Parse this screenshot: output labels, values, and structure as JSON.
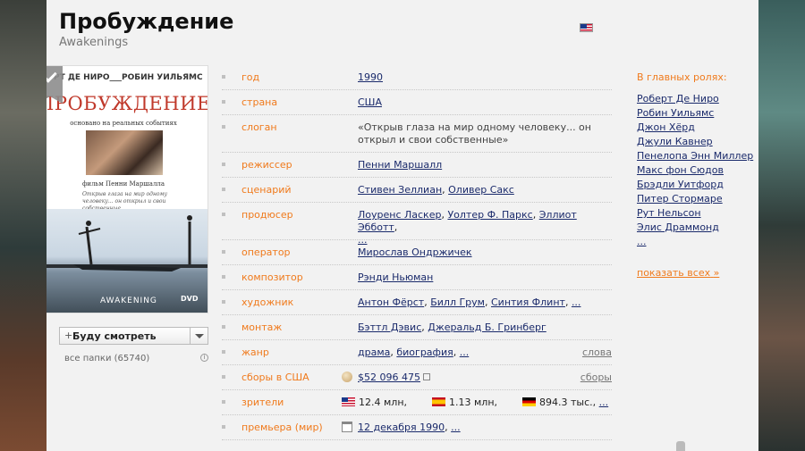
{
  "title": "Пробуждение",
  "original_title": "Awakenings",
  "poster": {
    "actors": "РТ ДЕ НИРО___РОБИН УИЛЬЯМС",
    "title": "ПРОБУЖДЕНИЕ",
    "tagline": "основано на реальных событиях",
    "director_line": "фильм Пенни Маршалла",
    "quote": "Открыв глаза на мир одному человеку... он открыл и свои собственные",
    "bottom": "AWAKENING",
    "dvd": "DVD"
  },
  "watch": {
    "plus": "+",
    "label": "Буду смотреть",
    "folders": "все папки (65740)",
    "info_icon": "i"
  },
  "info": {
    "year": {
      "label": "год",
      "value": "1990"
    },
    "country": {
      "label": "страна",
      "value": "США"
    },
    "slogan": {
      "label": "слоган",
      "value": "«Открыв глаза на мир одному человеку... он открыл и свои собственные»"
    },
    "director": {
      "label": "режиссер",
      "value": "Пенни Маршалл"
    },
    "writer": {
      "label": "сценарий",
      "values": [
        "Стивен Зеллиан",
        "Оливер Сакс"
      ]
    },
    "producer": {
      "label": "продюсер",
      "values": [
        "Лоуренс Ласкер",
        "Уолтер Ф. Паркс",
        "Эллиот Эбботт"
      ],
      "more": "..."
    },
    "operator": {
      "label": "оператор",
      "value": "Мирослав Ондржичек"
    },
    "composer": {
      "label": "композитор",
      "value": "Рэнди Ньюман"
    },
    "artist": {
      "label": "художник",
      "values": [
        "Антон Фёрст",
        "Билл Грум",
        "Синтия Флинт"
      ],
      "more": "..."
    },
    "editing": {
      "label": "монтаж",
      "values": [
        "Бэттл Дэвис",
        "Джеральд Б. Гринберг"
      ]
    },
    "genre": {
      "label": "жанр",
      "values": [
        "драма",
        "биография"
      ],
      "more": "...",
      "right_link": "слова"
    },
    "box_office": {
      "label": "сборы в США",
      "value": "$52 096 475",
      "right_link": "сборы"
    },
    "viewers": {
      "label": "зрители",
      "us": "12.4 млн,",
      "es": "1.13 млн,",
      "de": "894.3 тыс.,",
      "more": "..."
    },
    "premiere": {
      "label": "премьера (мир)",
      "value": "12 декабря 1990",
      "more": "..."
    }
  },
  "cast": {
    "title": "В главных ролях:",
    "items": [
      "Роберт Де Ниро",
      "Робин Уильямс",
      "Джон Хёрд",
      "Джули Кавнер",
      "Пенелопа Энн Миллер",
      "Макс фон Сюдов",
      "Брэдли Уитфорд",
      "Питер Стормаре",
      "Рут Нельсон",
      "Элис Драммонд"
    ],
    "more": "...",
    "show_all": "показать всех",
    "show_all_arrow": "»"
  },
  "colors": {
    "accent_label": "#f07a1c",
    "link": "#1a2a6b",
    "page_bg": "#f2f2f2"
  }
}
